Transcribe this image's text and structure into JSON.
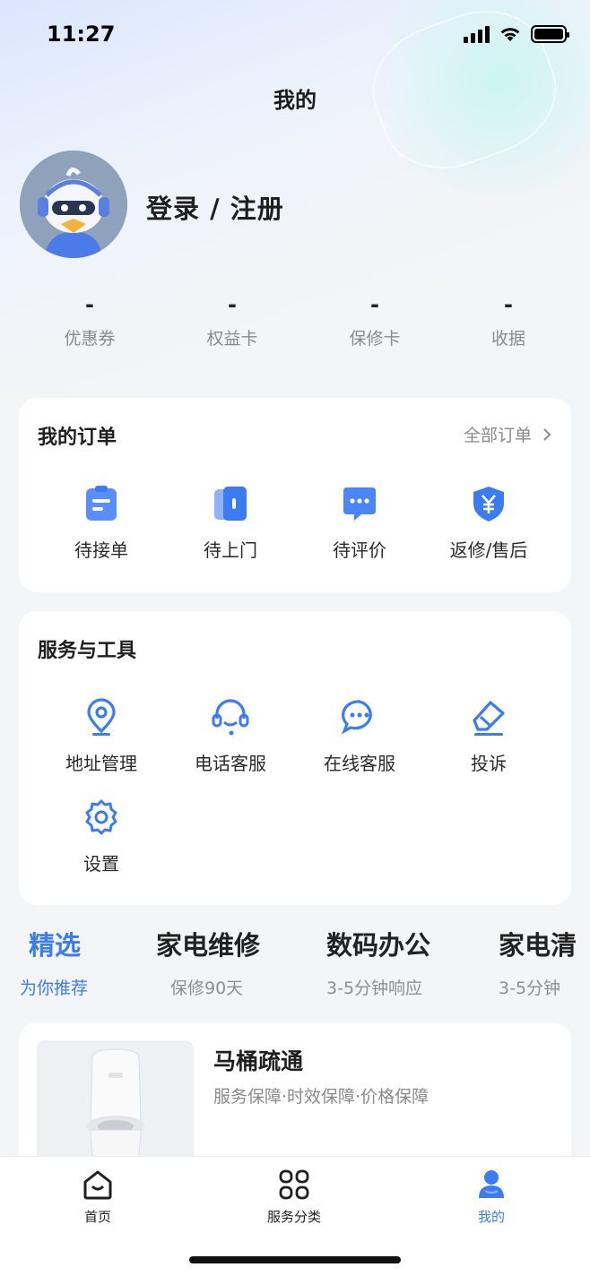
{
  "status_bar": {
    "time": "11:27"
  },
  "header": {
    "title": "我的"
  },
  "profile": {
    "login_label": "登录 / 注册"
  },
  "stats": [
    {
      "value": "-",
      "label": "优惠券"
    },
    {
      "value": "-",
      "label": "权益卡"
    },
    {
      "value": "-",
      "label": "保修卡"
    },
    {
      "value": "-",
      "label": "收据"
    }
  ],
  "orders": {
    "title": "我的订单",
    "all_link": "全部订单",
    "items": [
      {
        "label": "待接单",
        "icon": "clipboard-icon"
      },
      {
        "label": "待上门",
        "icon": "door-icon"
      },
      {
        "label": "待评价",
        "icon": "chat-bubble-icon"
      },
      {
        "label": "返修/售后",
        "icon": "yen-shield-icon"
      }
    ]
  },
  "services": {
    "title": "服务与工具",
    "items": [
      {
        "label": "地址管理",
        "icon": "location-pin-icon"
      },
      {
        "label": "电话客服",
        "icon": "headset-icon"
      },
      {
        "label": "在线客服",
        "icon": "chat-dots-icon"
      },
      {
        "label": "投诉",
        "icon": "eraser-icon"
      },
      {
        "label": "设置",
        "icon": "gear-icon"
      }
    ]
  },
  "categories": [
    {
      "name": "精选",
      "sub": "为你推荐",
      "active": true
    },
    {
      "name": "家电维修",
      "sub": "保修90天",
      "active": false
    },
    {
      "name": "数码办公",
      "sub": "3-5分钟响应",
      "active": false
    },
    {
      "name": "家电清",
      "sub": "3-5分钟",
      "active": false
    }
  ],
  "product": {
    "title": "马桶疏通",
    "tags": "服务保障·时效保障·价格保障"
  },
  "bottom_nav": [
    {
      "label": "首页",
      "icon": "home-icon",
      "active": false
    },
    {
      "label": "服务分类",
      "icon": "category-grid-icon",
      "active": false
    },
    {
      "label": "我的",
      "icon": "user-icon",
      "active": true
    }
  ],
  "colors": {
    "accent": "#3b7cf0",
    "accent_light": "#6ea0ff",
    "text": "#222222",
    "muted": "#8a8a8a"
  }
}
